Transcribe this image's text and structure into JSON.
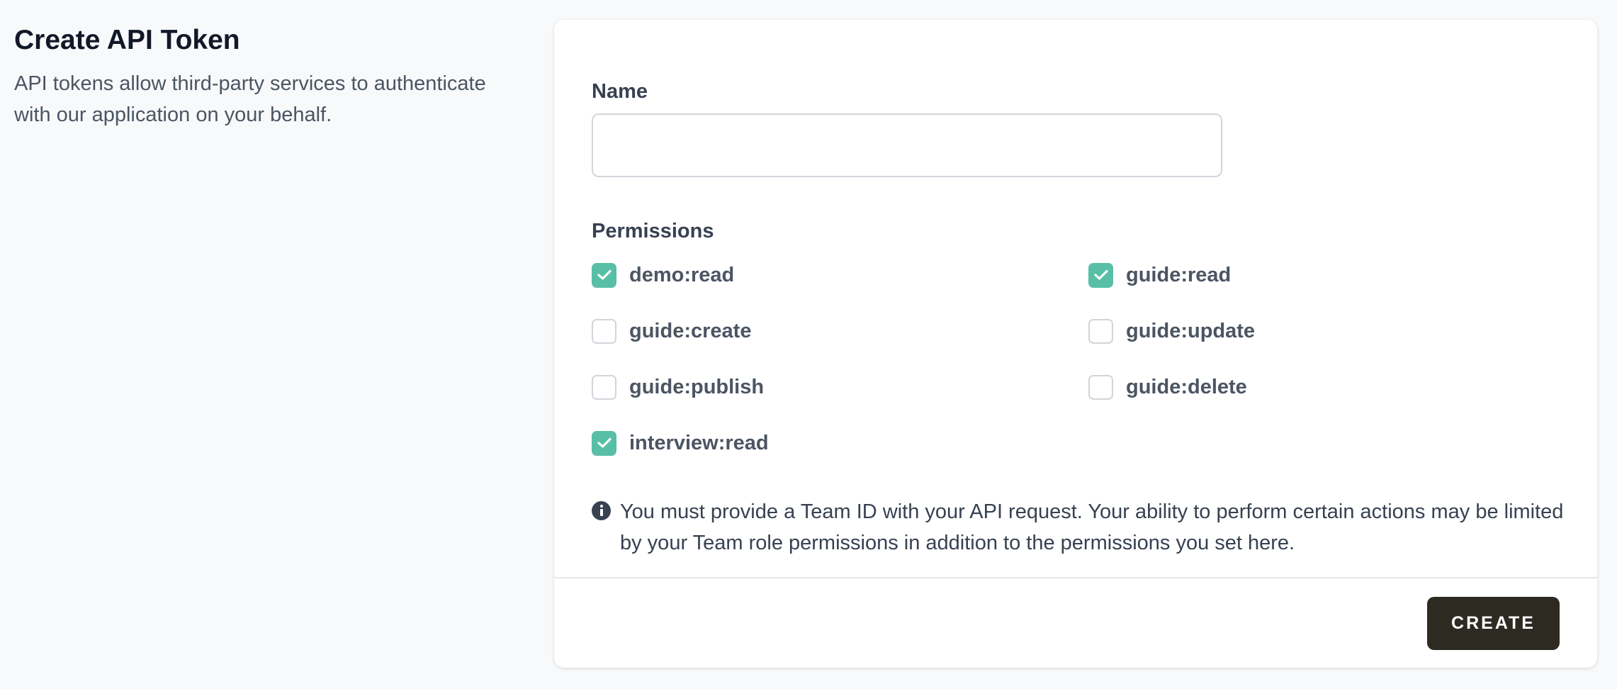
{
  "section": {
    "title": "Create API Token",
    "description": "API tokens allow third-party services to authenticate with our application on your behalf."
  },
  "form": {
    "name_label": "Name",
    "name_value": "",
    "name_placeholder": "",
    "permissions_label": "Permissions",
    "permissions": [
      {
        "label": "demo:read",
        "checked": true
      },
      {
        "label": "guide:read",
        "checked": true
      },
      {
        "label": "guide:create",
        "checked": false
      },
      {
        "label": "guide:update",
        "checked": false
      },
      {
        "label": "guide:publish",
        "checked": false
      },
      {
        "label": "guide:delete",
        "checked": false
      },
      {
        "label": "interview:read",
        "checked": true
      }
    ],
    "info_icon": "info-circle-icon",
    "info_text": "You must provide a Team ID with your API request. Your ability to perform certain actions may be limited by your Team role permissions in addition to the permissions you set here.",
    "check_color": "#58bfa6"
  },
  "actions": {
    "create_label": "CREATE",
    "create_color": "#2d2a21"
  }
}
